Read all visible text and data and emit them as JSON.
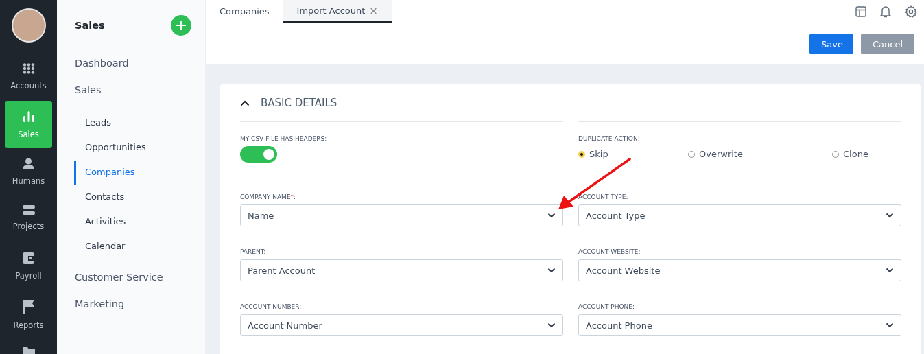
{
  "rail": {
    "items": [
      {
        "kind": "grid",
        "label": "Accounts",
        "selected": false
      },
      {
        "kind": "chart",
        "label": "Sales",
        "selected": true
      },
      {
        "kind": "person",
        "label": "Humans",
        "selected": false
      },
      {
        "kind": "bars",
        "label": "Projects",
        "selected": false
      },
      {
        "kind": "wallet",
        "label": "Payroll",
        "selected": false
      },
      {
        "kind": "flag",
        "label": "Reports",
        "selected": false
      },
      {
        "kind": "folder",
        "selected": false
      }
    ]
  },
  "sidebar": {
    "title": "Sales",
    "add_button": "+",
    "items": [
      {
        "label": "Dashboard",
        "selected": false
      },
      {
        "label": "Sales",
        "selected": false,
        "children": [
          {
            "label": "Leads",
            "selected": false
          },
          {
            "label": "Opportunities",
            "selected": false
          },
          {
            "label": "Companies",
            "selected": true
          },
          {
            "label": "Contacts",
            "selected": false
          },
          {
            "label": "Activities",
            "selected": false
          },
          {
            "label": "Calendar",
            "selected": false
          }
        ]
      },
      {
        "label": "Customer Service",
        "selected": false
      },
      {
        "label": "Marketing",
        "selected": false
      }
    ]
  },
  "tabs": [
    {
      "label": "Companies",
      "selected": false,
      "closable": false
    },
    {
      "label": "Import Account",
      "selected": true,
      "closable": true,
      "close": "×"
    }
  ],
  "toolbar": {
    "save": "Save",
    "cancel": "Cancel"
  },
  "section": {
    "title": "BASIC DETAILS",
    "expanded": true,
    "headers_toggle": {
      "label": "MY CSV FILE HAS HEADERS:",
      "on": true
    },
    "duplicate_action": {
      "label": "DUPLICATE ACTION:",
      "options": [
        {
          "label": "Skip",
          "selected": true
        },
        {
          "label": "Overwrite",
          "selected": false
        },
        {
          "label": "Clone",
          "selected": false
        }
      ]
    },
    "fields_left": [
      {
        "label": "COMPANY NAME",
        "required_mark": "*",
        "label_end": ":",
        "value": "Name"
      },
      {
        "label": "PARENT:",
        "placeholder": "Parent Account"
      },
      {
        "label": "ACCOUNT NUMBER:",
        "placeholder": "Account Number"
      }
    ],
    "fields_right": [
      {
        "label": "ACCOUNT TYPE:",
        "placeholder": "Account Type"
      },
      {
        "label": "ACCOUNT WEBSITE:",
        "placeholder": "Account Website"
      },
      {
        "label": "ACCOUNT PHONE:",
        "placeholder": "Account Phone"
      }
    ]
  }
}
